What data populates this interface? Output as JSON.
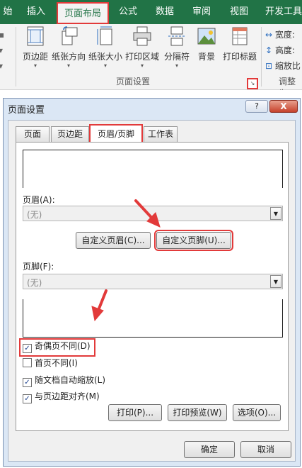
{
  "ribbon_tabs": [
    {
      "label": "始"
    },
    {
      "label": "插入"
    },
    {
      "label": "页面布局"
    },
    {
      "label": "公式"
    },
    {
      "label": "数据"
    },
    {
      "label": "审阅"
    },
    {
      "label": "视图"
    },
    {
      "label": "开发工具"
    }
  ],
  "ribbon": {
    "buttons": [
      {
        "label": "页边距",
        "icon": "margins-icon"
      },
      {
        "label": "纸张方向",
        "icon": "orientation-icon"
      },
      {
        "label": "纸张大小",
        "icon": "paper-size-icon"
      },
      {
        "label": "打印区域",
        "icon": "print-area-icon"
      },
      {
        "label": "分隔符",
        "icon": "breaks-icon"
      },
      {
        "label": "背景",
        "icon": "background-icon"
      },
      {
        "label": "打印标题",
        "icon": "print-titles-icon"
      }
    ],
    "group_page_setup": "页面设置",
    "scale": {
      "width": "宽度:",
      "height": "高度:",
      "ratio": "缩放比",
      "group": "调整为"
    }
  },
  "dialog": {
    "title": "页面设置",
    "help": "?",
    "close": "X",
    "tabs": [
      {
        "label": "页面"
      },
      {
        "label": "页边距"
      },
      {
        "label": "页眉/页脚"
      },
      {
        "label": "工作表"
      }
    ],
    "header_label": "页眉(A):",
    "header_value": "(无)",
    "custom_header": "自定义页眉(C)...",
    "custom_footer": "自定义页脚(U)...",
    "footer_label": "页脚(F):",
    "footer_value": "(无)",
    "options": [
      {
        "label": "奇偶页不同(D)",
        "checked": true
      },
      {
        "label": "首页不同(I)",
        "checked": false
      },
      {
        "label": "随文档自动缩放(L)",
        "checked": true
      },
      {
        "label": "与页边距对齐(M)",
        "checked": true
      }
    ],
    "print": "打印(P)...",
    "print_preview": "打印预览(W)",
    "options_btn": "选项(O)...",
    "ok": "确定",
    "cancel": "取消"
  },
  "colors": {
    "ribbon": "#217346",
    "highlight": "#e23a3a",
    "dialog_frame": "#dbe7f5"
  }
}
